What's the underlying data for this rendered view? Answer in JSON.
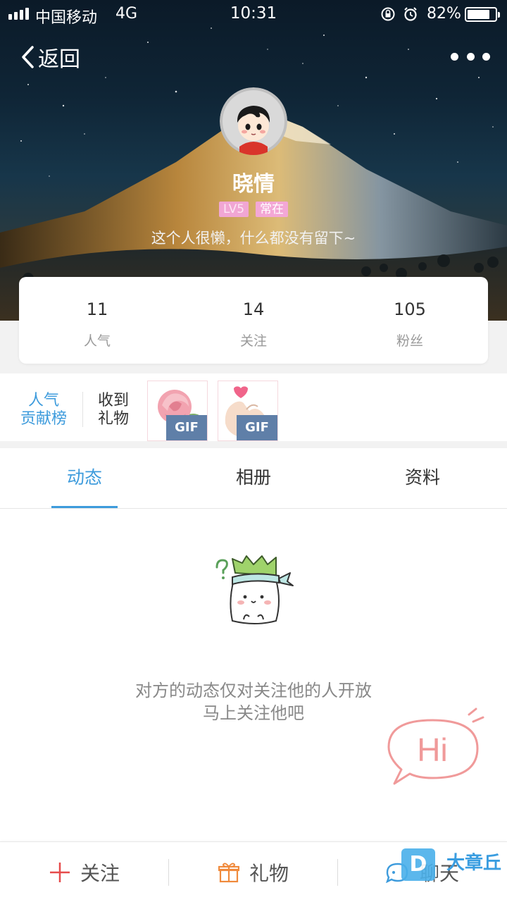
{
  "status_bar": {
    "carrier": "中国移动",
    "network": "4G",
    "time": "10:31",
    "battery_percent": "82%",
    "battery_level": 0.82
  },
  "header": {
    "back_label": "返回",
    "back_icon": "chevron-left-icon",
    "more_icon": "more-dots-icon"
  },
  "profile": {
    "name": "晓情",
    "tags": [
      "LV5",
      "常在"
    ],
    "bio": "这个人很懒，什么都没有留下~"
  },
  "stats": [
    {
      "value": "11",
      "label": "人气"
    },
    {
      "value": "14",
      "label": "关注"
    },
    {
      "value": "105",
      "label": "粉丝"
    }
  ],
  "gifts": {
    "rank_line1": "人气",
    "rank_line2": "贡献榜",
    "received_line1": "收到",
    "received_line2": "礼物",
    "items": [
      {
        "icon": "rose-icon",
        "badge": "GIF"
      },
      {
        "icon": "finger-heart-icon",
        "badge": "GIF"
      }
    ]
  },
  "tabs": {
    "items": [
      "动态",
      "相册",
      "资料"
    ],
    "active": 0
  },
  "empty_state": {
    "line1": "对方的动态仅对关注他的人开放",
    "line2": "马上关注他吧",
    "hi_text": "Hi"
  },
  "bottom_bar": {
    "follow": "关注",
    "gift": "礼物",
    "chat": "聊天"
  },
  "watermark": {
    "letter": "D",
    "text": "大章丘"
  },
  "colors": {
    "accent": "#3d9bdc",
    "tag_pink": "#f3a7d6",
    "follow_red": "#e64b4b",
    "gift_orange": "#f08a3c",
    "hi_pink": "#f09a9a"
  }
}
